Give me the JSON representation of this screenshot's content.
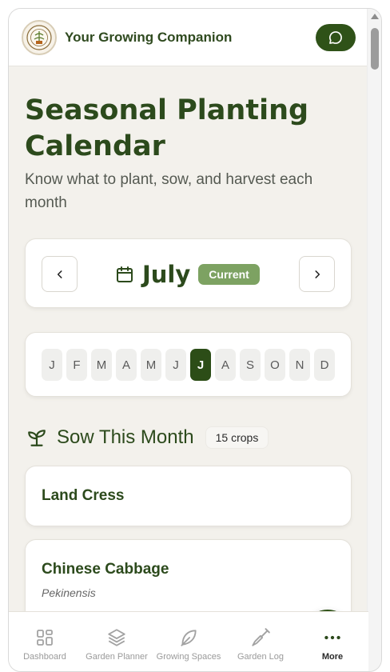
{
  "app": {
    "title": "Your Growing Companion"
  },
  "page": {
    "title": "Seasonal Planting Calendar",
    "subtitle": "Know what to plant, sow, and harvest each month"
  },
  "month_selector": {
    "month": "July",
    "badge": "Current",
    "prev_icon": "chevron-left-icon",
    "next_icon": "chevron-right-icon"
  },
  "month_strip": {
    "months": [
      "J",
      "F",
      "M",
      "A",
      "M",
      "J",
      "J",
      "A",
      "S",
      "O",
      "N",
      "D"
    ],
    "active_index": 6
  },
  "sow_section": {
    "title": "Sow This Month",
    "count": "15 crops",
    "crops": [
      {
        "name": "Land Cress",
        "latin": ""
      },
      {
        "name": "Chinese Cabbage",
        "latin": "Pekinensis"
      }
    ]
  },
  "bottom_nav": {
    "items": [
      {
        "label": "Dashboard",
        "icon": "grid-icon"
      },
      {
        "label": "Garden Planner",
        "icon": "layers-icon"
      },
      {
        "label": "Growing Spaces",
        "icon": "leaf-icon"
      },
      {
        "label": "Garden Log",
        "icon": "shovel-icon"
      },
      {
        "label": "More",
        "icon": "more-dots-icon"
      }
    ],
    "active": "More"
  },
  "colors": {
    "brand": "#2f5218",
    "badge": "#7da262",
    "background": "#f3f1ec"
  }
}
